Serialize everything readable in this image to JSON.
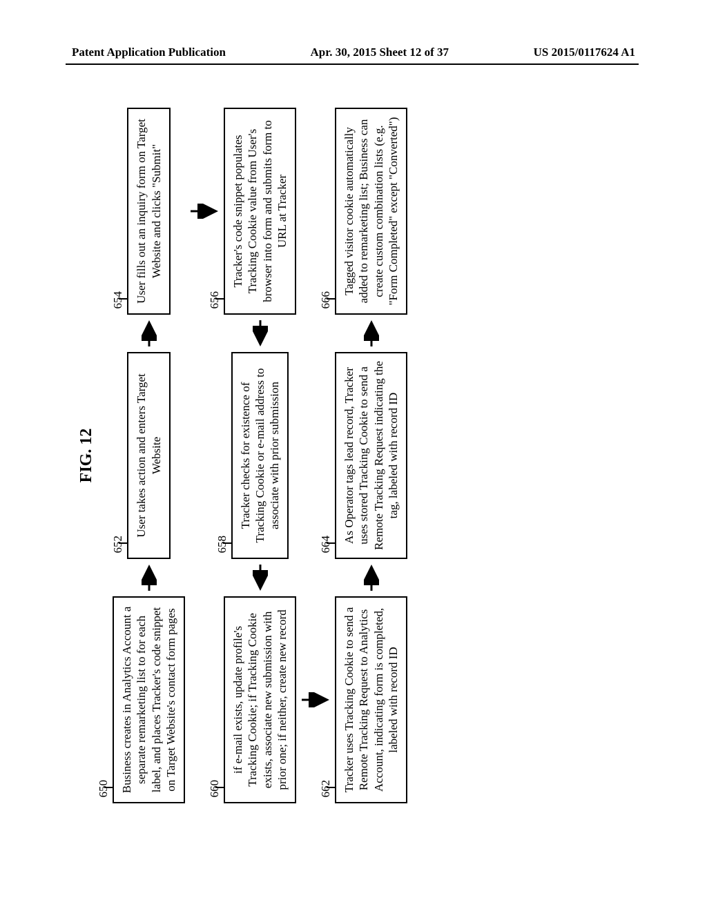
{
  "header": {
    "left": "Patent Application Publication",
    "center": "Apr. 30, 2015  Sheet 12 of 37",
    "right": "US 2015/0117624 A1"
  },
  "figure": {
    "title": "FIG. 12",
    "nodes": {
      "n650": {
        "ref": "650",
        "text": "Business creates in Analytics Account a separate remarketing list to for each label, and places Tracker's code snippet on Target Website's contact form pages"
      },
      "n652": {
        "ref": "652",
        "text": "User takes action  and enters Target Website"
      },
      "n654": {
        "ref": "654",
        "text": "User fills out an inquiry form on Target Website and clicks \"Submit\""
      },
      "n656": {
        "ref": "656",
        "text": "Tracker's code snippet populates Tracking Cookie value from User's browser into form and submits form to URL at Tracker"
      },
      "n658": {
        "ref": "658",
        "text": "Tracker checks for existence of Tracking Cookie or e-mail address to associate with prior submission"
      },
      "n660": {
        "ref": "660",
        "text": "if e-mail exists, update profile's Tracking Cookie; if Tracking Cookie exists, associate new submission with prior one; if neither, create new record"
      },
      "n662": {
        "ref": "662",
        "text": "Tracker uses Tracking Cookie to send a Remote Tracking Request to Analytics Account, indicating form is completed, labeled with record ID"
      },
      "n664": {
        "ref": "664",
        "text": "As Operator tags lead record, Tracker uses stored Tracking Cookie to send a Remote Tracking Request indicating the tag, labeled with record ID"
      },
      "n666": {
        "ref": "666",
        "text": "Tagged visitor cookie automatically added to remarketing list; Business can create custom combination lists (e.g. \"Form Completed\" except \"Converted\")"
      }
    }
  }
}
